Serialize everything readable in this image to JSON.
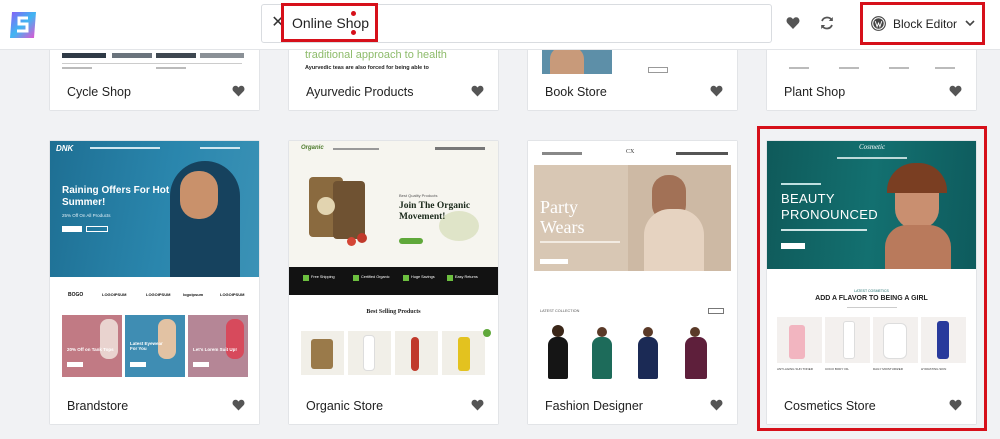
{
  "search": {
    "value": "Online Shop"
  },
  "editor": {
    "label": "Block Editor"
  },
  "icons": {
    "logo": "app-logo-icon",
    "clear": "close-icon",
    "favorites": "heart-icon",
    "refresh": "refresh-icon",
    "wordpress": "wordpress-icon",
    "dropdown": "chevron-down-icon"
  },
  "colors": {
    "highlight": "#d6101a"
  },
  "top_row": [
    {
      "name": "Cycle Shop"
    },
    {
      "name": "Ayurvedic Products",
      "preview_line1": "traditional approach to health",
      "preview_line2": "Ayurvedic teas are also forced for being able to"
    },
    {
      "name": "Book Store"
    },
    {
      "name": "Plant Shop"
    }
  ],
  "bottom_row": [
    {
      "name": "Brandstore",
      "hero_title": "Raining Offers For Hot Summer!",
      "hero_sub": "25% Off On All Products",
      "brands": [
        "BOGO",
        "LOGOIPSUM",
        "LOGOIPSUM",
        "logoipsum",
        "LOGOIPSUM"
      ],
      "promos": [
        "20% Off on Tank Tops",
        "Latest Eyewear For You",
        "Let's Lorem Suit Up!"
      ],
      "logo": "DNK"
    },
    {
      "name": "Organic Store",
      "logo": "Organic",
      "hero_kicker": "Best Quality Products",
      "hero_title": "Join The Organic Movement!",
      "features": [
        "Free Shipping",
        "Certified Organic",
        "Huge Savings",
        "Easy Returns"
      ],
      "section_title": "Best Selling Products"
    },
    {
      "name": "Fashion Designer",
      "logo": "CX",
      "hero_title": "Party Wears",
      "section_title": "LATEST COLLECTION"
    },
    {
      "name": "Cosmetics Store",
      "logo": "Cosmetic",
      "hero_title": "BEAUTY PRONOUNCED",
      "section_kicker": "LATEST COSMETICS",
      "section_title": "ADD A FLAVOR TO BEING A GIRL",
      "products": [
        "ANTI-AGING SUN TONER",
        "COCO BODY OIL",
        "DAILY MOISTURIZER",
        "HYDRATING SKIN"
      ]
    }
  ]
}
